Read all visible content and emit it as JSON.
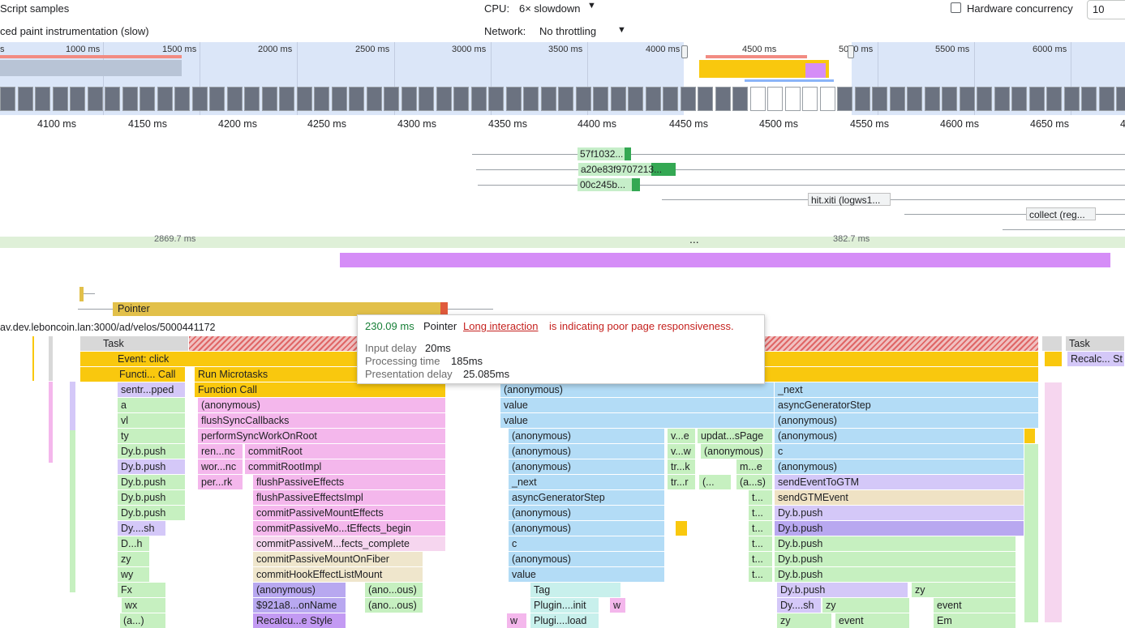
{
  "settings": {
    "script_samples": "Script samples",
    "paint_instrumentation": "ced paint instrumentation (slow)",
    "cpu_label": "CPU:",
    "cpu_value": "6× slowdown",
    "network_label": "Network:",
    "network_value": "No throttling",
    "hardware_concurrency_label": "Hardware concurrency",
    "hardware_concurrency_value": "10",
    "dropdown_icon": "caret-down-icon"
  },
  "overview": {
    "labels": [
      "s",
      "1000 ms",
      "1500 ms",
      "2000 ms",
      "2500 ms",
      "3000 ms",
      "3500 ms",
      "4000 ms",
      "4500 ms",
      "5000 ms",
      "5500 ms",
      "6000 ms"
    ]
  },
  "ruler": {
    "labels": [
      "4100 ms",
      "4150 ms",
      "4200 ms",
      "4250 ms",
      "4300 ms",
      "4350 ms",
      "4400 ms",
      "4450 ms",
      "4500 ms",
      "4550 ms",
      "4600 ms",
      "4650 ms",
      "4"
    ]
  },
  "network": {
    "requests": [
      "57f1032...",
      "a20e83f9707213...",
      "00c245b...",
      "hit.xiti (logws1...",
      "collect (reg..."
    ]
  },
  "frames": {
    "left": "2869.7 ms",
    "right": "382.7 ms",
    "more": "..."
  },
  "interactions": {
    "pointer_label": "Pointer"
  },
  "url": "av.dev.leboncoin.lan:3000/ad/velos/5000441172",
  "tooltip": {
    "duration": "230.09 ms",
    "type": "Pointer",
    "link": "Long interaction",
    "message": "is indicating poor page responsiveness.",
    "input_delay_label": "Input delay",
    "input_delay": "20ms",
    "processing_label": "Processing time",
    "processing": "185ms",
    "presentation_label": "Presentation delay",
    "presentation": "25.085ms"
  },
  "flame": {
    "rows": [
      [
        "Task",
        "Task"
      ],
      [
        "Event: click",
        "Recalc... St"
      ],
      [
        "Functi... Call",
        "Run Microtasks"
      ],
      [
        "sentr...pped",
        "Function Call",
        "(anonymous)",
        "_next"
      ],
      [
        "a",
        "(anonymous)",
        "value",
        "asyncGeneratorStep"
      ],
      [
        "vl",
        "flushSyncCallbacks",
        "value",
        "(anonymous)"
      ],
      [
        "ty",
        "performSyncWorkOnRoot",
        "(anonymous)",
        "v...e",
        "updat...sPage",
        "(anonymous)"
      ],
      [
        "Dy.b.push",
        "ren...nc",
        "commitRoot",
        "(anonymous)",
        "v...w",
        "(anonymous)",
        "c"
      ],
      [
        "Dy.b.push",
        "wor...nc",
        "commitRootImpl",
        "(anonymous)",
        "tr...k",
        "m...e",
        "(anonymous)"
      ],
      [
        "Dy.b.push",
        "per...rk",
        "flushPassiveEffects",
        "_next",
        "tr...r",
        "(...",
        "(a...s)",
        "sendEventToGTM"
      ],
      [
        "Dy.b.push",
        "flushPassiveEffectsImpl",
        "asyncGeneratorStep",
        "t...",
        "sendGTMEvent"
      ],
      [
        "Dy.b.push",
        "commitPassiveMountEffects",
        "(anonymous)",
        "t...",
        "Dy.b.push"
      ],
      [
        "Dy....sh",
        "commitPassiveMo...tEffects_begin",
        "(anonymous)",
        "t...",
        "Dy.b.push"
      ],
      [
        "D...h",
        "commitPassiveM...fects_complete",
        "c",
        "t...",
        "Dy.b.push"
      ],
      [
        "zy",
        "commitPassiveMountOnFiber",
        "(anonymous)",
        "t...",
        "Dy.b.push"
      ],
      [
        "wy",
        "commitHookEffectListMount",
        "value",
        "t...",
        "Dy.b.push"
      ],
      [
        "Fx",
        "(anonymous)",
        "(ano...ous)",
        "Tag",
        "Dy.b.push",
        "zy"
      ],
      [
        "wx",
        "$921a8...onName",
        "(ano...ous)",
        "Plugin....init",
        "w",
        "Dy....sh",
        "zy",
        "event"
      ],
      [
        "(a...)",
        "Recalcu...e Style",
        "w",
        "Plugi....load",
        "zy",
        "event",
        "Em"
      ]
    ]
  }
}
